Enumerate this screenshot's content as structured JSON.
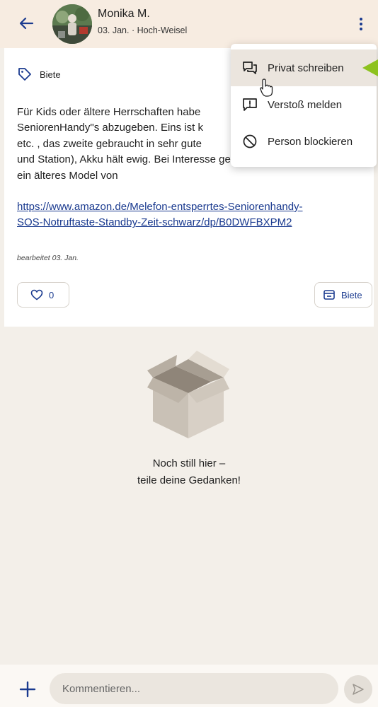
{
  "header": {
    "name": "Monika M.",
    "date": "03. Jan.",
    "separator": "·",
    "location": "Hoch-Weisel"
  },
  "post": {
    "tag_label": "Biete",
    "body": "Für Kids oder ältere Herrschaften habe\nSeniorenHandy\"s abzugeben. Eins ist k\netc. , das zweite gebraucht in sehr gute\nund Station), Akku hält ewig.  Bei Interesse gerne melden. Ist\nein älteres Model von",
    "link": "https://www.amazon.de/Melefon-entsperrtes-Seniorenhandy-\nSOS-Notruftaste-Standby-Zeit-schwarz/dp/B0DWFBXPM2",
    "edited": "bearbeitet 03. Jan.",
    "likes": "0",
    "type_button": "Biete"
  },
  "empty_state": {
    "text": "Noch still hier –\nteile deine Gedanken!"
  },
  "composer": {
    "placeholder": "Kommentieren..."
  },
  "menu": {
    "items": [
      {
        "label": "Privat schreiben",
        "icon": "chat-icon",
        "highlighted": true
      },
      {
        "label": "Verstoß melden",
        "icon": "report-icon",
        "highlighted": false
      },
      {
        "label": "Person blockieren",
        "icon": "block-icon",
        "highlighted": false
      }
    ]
  },
  "colors": {
    "accent": "#1a3a8f",
    "header_bg": "#f7ece1",
    "pointer_arrow": "#8dc21f"
  }
}
